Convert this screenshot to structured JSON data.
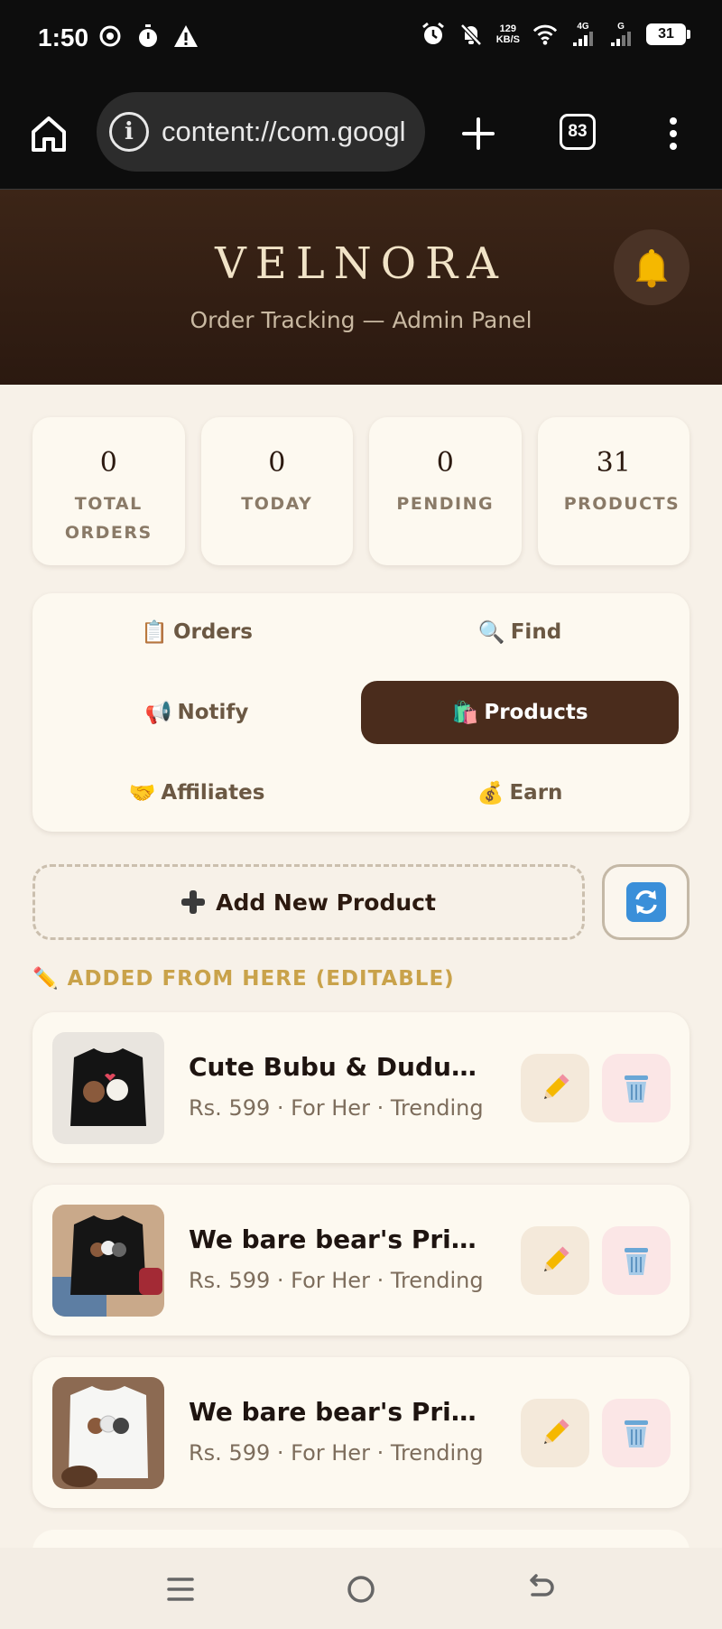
{
  "status_bar": {
    "time": "1:50",
    "net_speed_value": "129",
    "net_speed_unit": "KB/S",
    "signal_1_label": "4G",
    "signal_2_label": "G",
    "battery": "31"
  },
  "browser": {
    "url": "content://com.googl",
    "tab_count": "83"
  },
  "header": {
    "brand": "VELNORA",
    "subtitle": "Order Tracking — Admin Panel"
  },
  "stats": [
    {
      "value": "0",
      "label": "TOTAL ORDERS"
    },
    {
      "value": "0",
      "label": "TODAY"
    },
    {
      "value": "0",
      "label": "PENDING"
    },
    {
      "value": "31",
      "label": "PRODUCTS"
    }
  ],
  "tabs": [
    {
      "emoji": "📋",
      "label": "Orders"
    },
    {
      "emoji": "🔍",
      "label": "Find"
    },
    {
      "emoji": "📢",
      "label": "Notify"
    },
    {
      "emoji": "🛍️",
      "label": "Products",
      "active": true
    },
    {
      "emoji": "🤝",
      "label": "Affiliates"
    },
    {
      "emoji": "💰",
      "label": "Earn"
    }
  ],
  "add_product_label": "Add New Product",
  "section_title": "✏️ ADDED FROM HERE (EDITABLE)",
  "products": [
    {
      "name": "Cute Bubu & Dudu Printed T-Shirt",
      "meta": "Rs. 599 · For Her · Trending"
    },
    {
      "name": "We bare bear's Printed T-Shirt",
      "meta": "Rs. 599 · For Her · Trending"
    },
    {
      "name": "We bare bear's Printed T-Shirt",
      "meta": "Rs. 599 · For Her · Trending"
    }
  ],
  "icons": {
    "home": "home-icon",
    "info": "info-icon",
    "new_tab": "plus-icon",
    "menu": "more-vertical-icon",
    "bell": "bell-icon",
    "refresh": "refresh-icon",
    "edit": "pencil-icon",
    "delete": "trash-icon"
  },
  "colors": {
    "header_bg": "#3c2517",
    "active_tab": "#4a2c1c",
    "section_title": "#c9a24a",
    "page_bg": "#f7f1e8"
  }
}
